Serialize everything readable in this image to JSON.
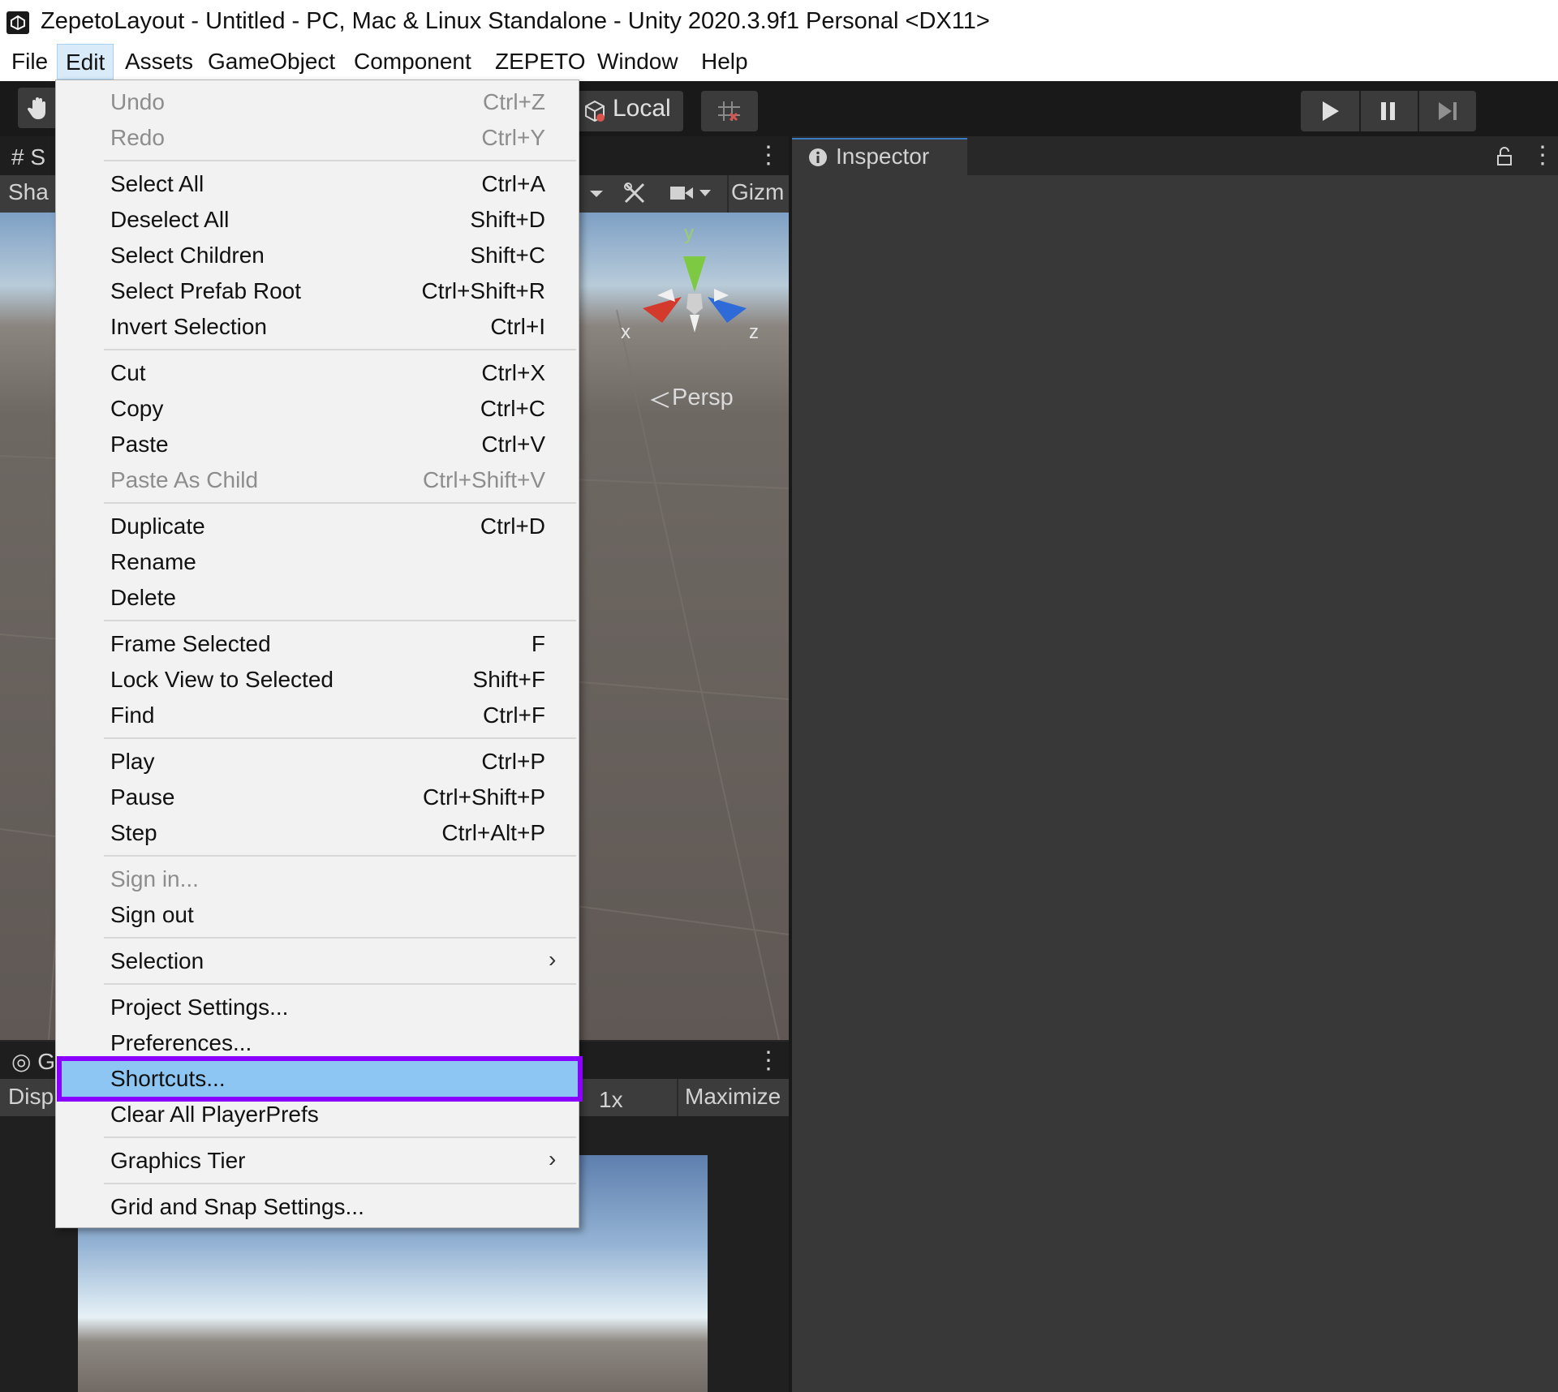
{
  "window": {
    "title": "ZepetoLayout - Untitled - PC, Mac & Linux Standalone - Unity 2020.3.9f1 Personal <DX11>"
  },
  "menubar": {
    "items": [
      "File",
      "Edit",
      "Assets",
      "GameObject",
      "Component",
      "ZEPETO",
      "Window",
      "Help"
    ],
    "active": "Edit"
  },
  "toolbar": {
    "pivot_rotation_label": "Local"
  },
  "scene": {
    "tab_label": "S",
    "shading_label": "Sha",
    "gizmos_label": "Gizm",
    "persp_label": "Persp",
    "axes": {
      "x": "x",
      "y": "y",
      "z": "z"
    }
  },
  "game": {
    "tab_label": "G",
    "display_label": "Disp",
    "scale_label": "1x",
    "maximize_label": "Maximize"
  },
  "inspector": {
    "tab_label": "Inspector"
  },
  "edit_menu": {
    "items": [
      {
        "label": "Undo",
        "shortcut": "Ctrl+Z",
        "disabled": true
      },
      {
        "label": "Redo",
        "shortcut": "Ctrl+Y",
        "disabled": true
      },
      {
        "label": "Select All",
        "shortcut": "Ctrl+A"
      },
      {
        "label": "Deselect All",
        "shortcut": "Shift+D"
      },
      {
        "label": "Select Children",
        "shortcut": "Shift+C"
      },
      {
        "label": "Select Prefab Root",
        "shortcut": "Ctrl+Shift+R"
      },
      {
        "label": "Invert Selection",
        "shortcut": "Ctrl+I"
      },
      {
        "label": "Cut",
        "shortcut": "Ctrl+X"
      },
      {
        "label": "Copy",
        "shortcut": "Ctrl+C"
      },
      {
        "label": "Paste",
        "shortcut": "Ctrl+V"
      },
      {
        "label": "Paste As Child",
        "shortcut": "Ctrl+Shift+V",
        "disabled": true
      },
      {
        "label": "Duplicate",
        "shortcut": "Ctrl+D"
      },
      {
        "label": "Rename",
        "shortcut": ""
      },
      {
        "label": "Delete",
        "shortcut": ""
      },
      {
        "label": "Frame Selected",
        "shortcut": "F"
      },
      {
        "label": "Lock View to Selected",
        "shortcut": "Shift+F"
      },
      {
        "label": "Find",
        "shortcut": "Ctrl+F"
      },
      {
        "label": "Play",
        "shortcut": "Ctrl+P"
      },
      {
        "label": "Pause",
        "shortcut": "Ctrl+Shift+P"
      },
      {
        "label": "Step",
        "shortcut": "Ctrl+Alt+P"
      },
      {
        "label": "Sign in...",
        "shortcut": "",
        "disabled": true
      },
      {
        "label": "Sign out",
        "shortcut": ""
      },
      {
        "label": "Selection",
        "shortcut": "",
        "submenu": true
      },
      {
        "label": "Project Settings...",
        "shortcut": ""
      },
      {
        "label": "Preferences...",
        "shortcut": ""
      },
      {
        "label": "Shortcuts...",
        "shortcut": "",
        "highlighted": true
      },
      {
        "label": "Clear All PlayerPrefs",
        "shortcut": ""
      },
      {
        "label": "Graphics Tier",
        "shortcut": "",
        "submenu": true
      },
      {
        "label": "Grid and Snap Settings...",
        "shortcut": ""
      }
    ]
  },
  "colors": {
    "highlight_fill": "#8ec6f3",
    "highlight_border": "#8a00ff",
    "menu_bg": "#f2f2f2",
    "editor_bg": "#383838"
  }
}
